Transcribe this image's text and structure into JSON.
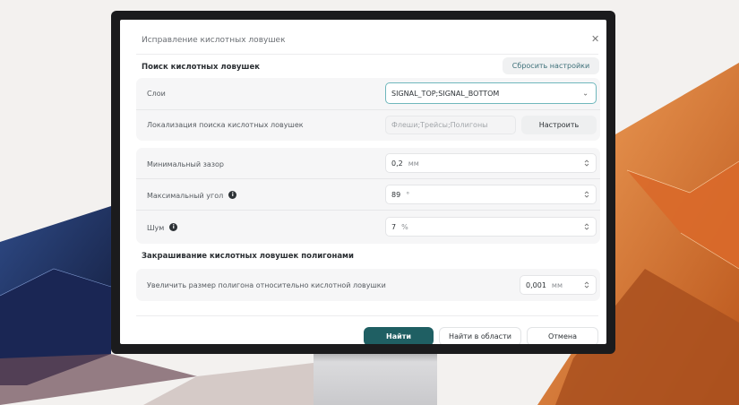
{
  "dialog": {
    "title": "Исправление кислотных ловушек",
    "close_icon": "close-icon"
  },
  "search": {
    "heading": "Поиск кислотных ловушек",
    "reset_label": "Сбросить настройки",
    "layers": {
      "label": "Слои",
      "value": "SIGNAL_TOP;SIGNAL_BOTTOM"
    },
    "localization": {
      "label": "Локализация поиска кислотных ловушек",
      "value": "Флеши;Трейсы;Полигоны",
      "button": "Настроить"
    },
    "min_gap": {
      "label": "Минимальный зазор",
      "value": "0,2",
      "unit": "мм"
    },
    "max_angle": {
      "label": "Максимальный угол",
      "value": "89",
      "unit": "°"
    },
    "noise": {
      "label": "Шум",
      "value": "7",
      "unit": "%"
    }
  },
  "fill": {
    "heading": "Закрашивание кислотных ловушек полигонами",
    "enlarge": {
      "label": "Увеличить размер полигона относительно кислотной ловушки",
      "value": "0,001",
      "unit": "мм"
    }
  },
  "footer": {
    "find": "Найти",
    "find_in_area": "Найти в области",
    "cancel": "Отмена"
  },
  "colors": {
    "primary": "#1f5f63",
    "accent_border": "#6fb7bc",
    "background_blue": "#1f2e5c",
    "background_orange": "#e07a2e"
  }
}
